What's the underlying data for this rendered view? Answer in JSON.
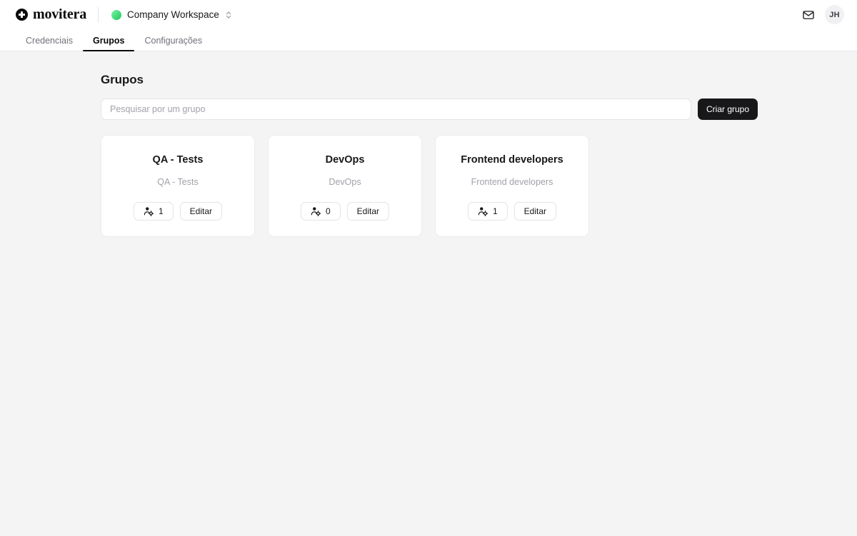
{
  "header": {
    "brand_name": "movitera",
    "brand_icon": "plus-circle-icon",
    "workspace_name": "Company Workspace",
    "workspace_dot_color": "#4ade80",
    "workspace_selector_icon": "chevron-up-down-icon",
    "mail_icon": "mail-icon",
    "avatar_initials": "JH"
  },
  "tabs": [
    {
      "label": "Credenciais",
      "active": false
    },
    {
      "label": "Grupos",
      "active": true
    },
    {
      "label": "Configurações",
      "active": false
    }
  ],
  "main": {
    "page_title": "Grupos",
    "search": {
      "placeholder": "Pesquisar por um grupo",
      "value": ""
    },
    "create_button_label": "Criar grupo",
    "accent_color": "#18181b",
    "cards": [
      {
        "title": "QA - Tests",
        "description": "QA - Tests",
        "members_icon": "user-cog-icon",
        "members_count": "1",
        "edit_label": "Editar"
      },
      {
        "title": "DevOps",
        "description": "DevOps",
        "members_icon": "user-cog-icon",
        "members_count": "0",
        "edit_label": "Editar"
      },
      {
        "title": "Frontend developers",
        "description": "Frontend developers",
        "members_icon": "user-cog-icon",
        "members_count": "1",
        "edit_label": "Editar"
      }
    ]
  }
}
